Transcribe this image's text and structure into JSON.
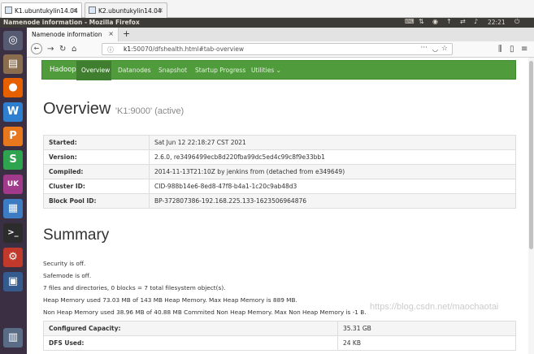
{
  "vm_tabs": [
    {
      "label": "K1.ubuntukylin14.04"
    },
    {
      "label": "K2.ubuntukylin14.04"
    }
  ],
  "os_panel": {
    "window_title": "Namenode information - Mozilla Firefox",
    "clock": "22:21"
  },
  "launcher": {
    "items": [
      {
        "name": "dash-icon",
        "glyph": "◎",
        "color": "#565b72"
      },
      {
        "name": "files-icon",
        "glyph": "▤",
        "color": "#8a6d4f"
      },
      {
        "name": "firefox-icon",
        "glyph": "●",
        "color": "#e66000"
      },
      {
        "name": "wps-writer-icon",
        "glyph": "W",
        "color": "#2f7fd1"
      },
      {
        "name": "wps-presentation-icon",
        "glyph": "P",
        "color": "#e8771e"
      },
      {
        "name": "wps-spreadsheet-icon",
        "glyph": "S",
        "color": "#2ea44f"
      },
      {
        "name": "kylin-software-center-icon",
        "glyph": "UK",
        "color": "#a23a8c"
      },
      {
        "name": "system-monitor-icon",
        "glyph": "▦",
        "color": "#3d7cc2"
      },
      {
        "name": "terminal-icon",
        "glyph": ">_",
        "color": "#2c2c2c"
      },
      {
        "name": "system-settings-icon",
        "glyph": "⚙",
        "color": "#c0392b"
      },
      {
        "name": "remote-desktop-icon",
        "glyph": "▣",
        "color": "#355b8e"
      },
      {
        "name": "workspace-switcher-icon",
        "glyph": "▥",
        "color": "#5a6c85"
      }
    ]
  },
  "browser": {
    "tab_title": "Namenode information",
    "url_host": "k1",
    "url_rest": ":50070/dfshealth.html#tab-overview"
  },
  "hadoop_nav": {
    "brand": "Hadoop",
    "items": [
      {
        "label": "Overview",
        "active": true
      },
      {
        "label": "Datanodes",
        "active": false
      },
      {
        "label": "Snapshot",
        "active": false
      },
      {
        "label": "Startup Progress",
        "active": false
      },
      {
        "label": "Utilities ⌄",
        "active": false
      }
    ]
  },
  "overview": {
    "title": "Overview",
    "subtitle": "'K1:9000' (active)",
    "rows": [
      {
        "key": "Started:",
        "value": "Sat Jun 12 22:18:27 CST 2021"
      },
      {
        "key": "Version:",
        "value": "2.6.0, re3496499ecb8d220fba99dc5ed4c99c8f9e33bb1"
      },
      {
        "key": "Compiled:",
        "value": "2014-11-13T21:10Z by jenkins from (detached from e349649)"
      },
      {
        "key": "Cluster ID:",
        "value": "CID-988b14e6-8ed8-47f8-b4a1-1c20c9ab48d3"
      },
      {
        "key": "Block Pool ID:",
        "value": "BP-372807386-192.168.225.133-1623506964876"
      }
    ]
  },
  "summary": {
    "title": "Summary",
    "lines": [
      "Security is off.",
      "Safemode is off.",
      "7 files and directories, 0 blocks = 7 total filesystem object(s).",
      "Heap Memory used 73.03 MB of 143 MB Heap Memory. Max Heap Memory is 889 MB.",
      "Non Heap Memory used 38.96 MB of 40.88 MB Commited Non Heap Memory. Max Non Heap Memory is -1 B."
    ],
    "capacity_rows": [
      {
        "key": "Configured Capacity:",
        "value": "35.31 GB"
      },
      {
        "key": "DFS Used:",
        "value": "24 KB"
      }
    ]
  },
  "watermark": "https://blog.csdn.net/maochaotai"
}
